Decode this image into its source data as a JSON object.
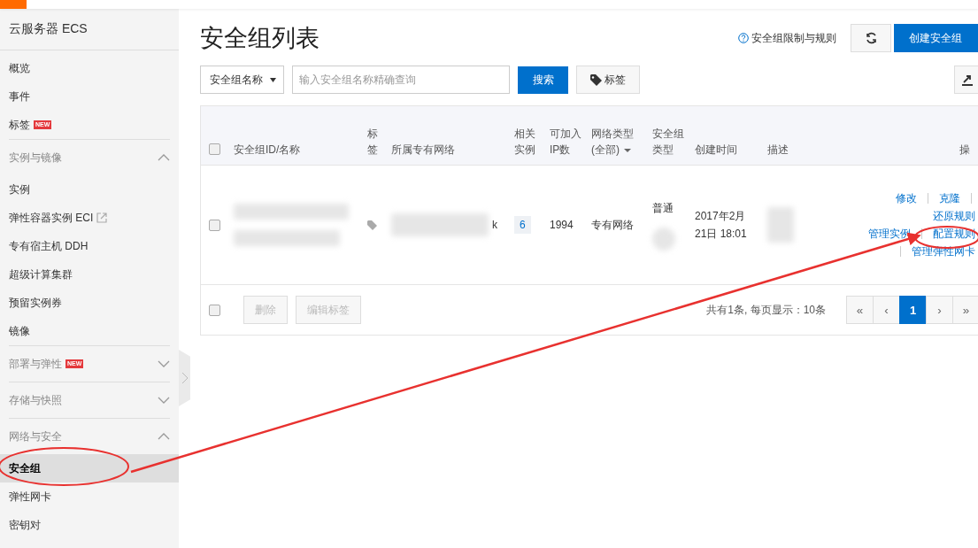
{
  "sidebar": {
    "title": "云服务器 ECS",
    "items": [
      {
        "kind": "item",
        "label": "概览",
        "selected": false
      },
      {
        "kind": "item",
        "label": "事件",
        "selected": false
      },
      {
        "kind": "item",
        "label": "标签",
        "selected": false,
        "badge": "NEW"
      },
      {
        "kind": "section",
        "label": "实例与镜像",
        "expanded": true
      },
      {
        "kind": "item",
        "label": "实例",
        "selected": false
      },
      {
        "kind": "item",
        "label": "弹性容器实例 ECI",
        "selected": false,
        "external": true
      },
      {
        "kind": "item",
        "label": "专有宿主机 DDH",
        "selected": false
      },
      {
        "kind": "item",
        "label": "超级计算集群",
        "selected": false
      },
      {
        "kind": "item",
        "label": "预留实例券",
        "selected": false
      },
      {
        "kind": "item",
        "label": "镜像",
        "selected": false
      },
      {
        "kind": "section",
        "label": "部署与弹性",
        "expanded": false,
        "badge": "NEW"
      },
      {
        "kind": "section",
        "label": "存储与快照",
        "expanded": false
      },
      {
        "kind": "section",
        "label": "网络与安全",
        "expanded": true
      },
      {
        "kind": "item",
        "label": "安全组",
        "selected": true
      },
      {
        "kind": "item",
        "label": "弹性网卡",
        "selected": false
      },
      {
        "kind": "item",
        "label": "密钥对",
        "selected": false
      }
    ]
  },
  "page": {
    "title": "安全组列表",
    "help_link": "安全组限制与规则",
    "create_button": "创建安全组"
  },
  "search": {
    "field_select": "安全组名称",
    "placeholder": "输入安全组名称精确查询",
    "search_button": "搜索",
    "tag_button": "标签"
  },
  "table": {
    "all_checked": false,
    "columns": [
      {
        "label": "安全组ID/名称"
      },
      {
        "label": "标签"
      },
      {
        "label": "所属专有网络"
      },
      {
        "label": "相关实例"
      },
      {
        "label": "可加入IP数"
      },
      {
        "label": "网络类型(全部)",
        "filter": true
      },
      {
        "label": "安全组类型"
      },
      {
        "label": "创建时间"
      },
      {
        "label": "描述"
      },
      {
        "label": "操"
      }
    ],
    "rows": [
      {
        "checked": false,
        "vpc_tail": "k",
        "instances": "6",
        "ip_count": "1994",
        "network_type": "专有网络",
        "group_type": "普通",
        "created": "2017年2月21日 18:01",
        "actions": [
          [
            "修改",
            "克隆"
          ],
          [
            "还原规则"
          ],
          [
            "管理实例",
            "配置规则"
          ],
          [
            "管理弹性网卡"
          ]
        ]
      }
    ],
    "footer": {
      "checked": false,
      "buttons": [
        "删除",
        "编辑标签"
      ],
      "summary": "共有1条, 每页显示：10条",
      "pages": [
        {
          "label": "«",
          "selected": false
        },
        {
          "label": "‹",
          "selected": false
        },
        {
          "label": "1",
          "selected": true
        },
        {
          "label": "›",
          "selected": false
        },
        {
          "label": "»",
          "selected": false
        }
      ]
    }
  }
}
